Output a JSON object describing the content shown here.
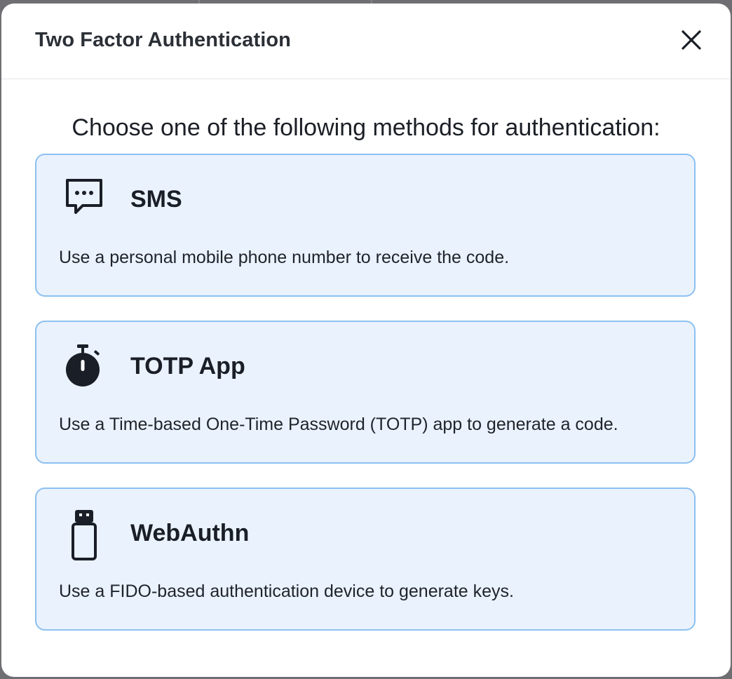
{
  "modal": {
    "title": "Two Factor Authentication",
    "close_icon": "close-icon",
    "intro": "Choose one of the following methods for authentication:"
  },
  "methods": [
    {
      "icon": "chat-bubble-icon",
      "title": "SMS",
      "description": "Use a personal mobile phone number to receive the code."
    },
    {
      "icon": "stopwatch-icon",
      "title": "TOTP App",
      "description": "Use a Time-based One-Time Password (TOTP) app to generate a code."
    },
    {
      "icon": "usb-key-icon",
      "title": "WebAuthn",
      "description": "Use a FIDO-based authentication device to generate keys."
    }
  ],
  "colors": {
    "card_background": "#eaf2fd",
    "card_border": "#8cc1f0",
    "text_primary": "#1a1e26",
    "backdrop": "#6f6f73"
  }
}
